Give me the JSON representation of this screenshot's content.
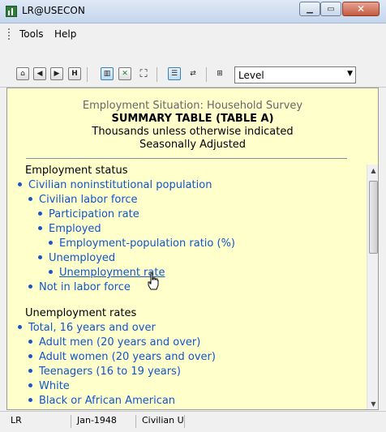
{
  "window": {
    "title": "LR@USECON"
  },
  "menu": {
    "items": [
      "Tools",
      "Help"
    ]
  },
  "toolbar": {
    "level_value": "Level"
  },
  "content": {
    "subtitle": "Employment Situation: Household Survey",
    "title": "SUMMARY TABLE (TABLE A)",
    "line1": "Thousands unless otherwise indicated",
    "line2": "Seasonally Adjusted",
    "section1": "Employment status",
    "items1": [
      "Civilian noninstitutional population",
      "Civilian labor force",
      "Participation rate",
      "Employed",
      "Employment-population ratio (%)",
      "Unemployed",
      "Unemployment rate",
      "Not in labor force"
    ],
    "section2": "Unemployment rates",
    "items2": [
      "Total, 16 years and over",
      "Adult men (20 years and over)",
      "Adult women (20 years and over)",
      "Teenagers (16 to 19 years)",
      "White",
      "Black or African American"
    ]
  },
  "status": {
    "cell1": "LR",
    "cell2": "Jan-1948",
    "cell3": "Civilian Ur"
  }
}
